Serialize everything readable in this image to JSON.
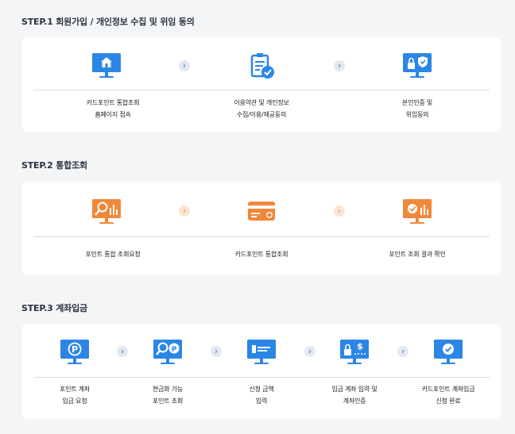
{
  "colors": {
    "blue": "#2b86e6",
    "orange": "#f0883a",
    "bg": "#f4f5f7"
  },
  "step1": {
    "title": "STEP.1 회원가입 / 개인정보 수집 및 위임 동의",
    "items": [
      {
        "icon": "monitor-home-icon",
        "line1": "카드포인트 통합조회",
        "line2": "홈페이지 접속"
      },
      {
        "icon": "clipboard-check-icon",
        "line1": "이용약관 및 개인정보",
        "line2": "수집/이용/제공동의"
      },
      {
        "icon": "monitor-lock-shield-icon",
        "line1": "본인인증 및",
        "line2": "위임동의"
      }
    ]
  },
  "step2": {
    "title": "STEP.2 통합조회",
    "items": [
      {
        "icon": "monitor-search-chart-icon",
        "line1": "포인트 통합 조회요청"
      },
      {
        "icon": "credit-card-icon",
        "line1": "카드포인트 통합조회"
      },
      {
        "icon": "monitor-check-chart-icon",
        "line1": "포인트 조회 결과 확인"
      }
    ]
  },
  "step3": {
    "title": "STEP.3 계좌입금",
    "items": [
      {
        "icon": "monitor-point-icon",
        "line1": "포인트 계좌",
        "line2": "입금 요청"
      },
      {
        "icon": "monitor-search-point-icon",
        "line1": "현금화 가능",
        "line2": "포인트 조회"
      },
      {
        "icon": "monitor-input-icon",
        "line1": "신청 금액",
        "line2": "입력"
      },
      {
        "icon": "monitor-lock-dollar-icon",
        "line1": "입금 계좌 입력 및",
        "line2": "계좌인증"
      },
      {
        "icon": "monitor-check-icon",
        "line1": "카드포인트 계좌입금",
        "line2": "신청 완료"
      }
    ]
  }
}
